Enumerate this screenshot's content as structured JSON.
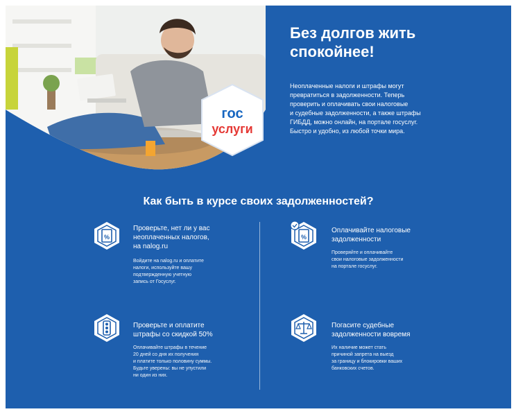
{
  "headline": {
    "line1": "Без долгов жить",
    "line2": "спокойнее!"
  },
  "intro": [
    "Неоплаченные налоги и штрафы могут",
    "превратиться в задолженности. Теперь",
    "проверить и оплачивать свои налоговые",
    "и судебные задолженности, а также штрафы",
    "ГИБДД, можно онлайн, на портале госуслуг.",
    "Быстро и удобно, из любой точки мира."
  ],
  "logo": {
    "line1": "гос",
    "line2": "услуги"
  },
  "section_title": "Как быть в курсе своих задолженностей?",
  "features": [
    {
      "icon": "document-percent-icon",
      "title": [
        "Проверьте, нет ли у вас",
        "неоплаченных налогов,",
        "на nalog.ru"
      ],
      "text": [
        "Войдите на nalog.ru и оплатите",
        "налоги, используйте вашу",
        "подтвержденную учетную",
        "запись от Госуслуг."
      ]
    },
    {
      "icon": "document-percent-check-icon",
      "title": [
        "Оплачивайте налоговые",
        "задолженности"
      ],
      "text": [
        "Проверяйте и оплачивайте",
        "свои налоговые задолженности",
        "на портале госуслуг."
      ]
    },
    {
      "icon": "traffic-light-icon",
      "title": [
        "Проверьте и оплатите",
        "штрафы со скидкой 50%"
      ],
      "text": [
        "Оплачивайте штрафы в течение",
        "20 дней со дня их получения",
        "и платите только половину суммы.",
        "Будьте уверены: вы не упустили",
        "ни один из них."
      ]
    },
    {
      "icon": "scales-icon",
      "title": [
        "Погасите судебные",
        "задолженности вовремя"
      ],
      "text": [
        "Их наличие может стать",
        "причиной запрета на выезд",
        "за границу и блокировки ваших",
        "банковских счетов."
      ]
    }
  ],
  "colors": {
    "brand_blue": "#1e5fae",
    "logo_blue": "#1565c0",
    "logo_red": "#e53935"
  }
}
